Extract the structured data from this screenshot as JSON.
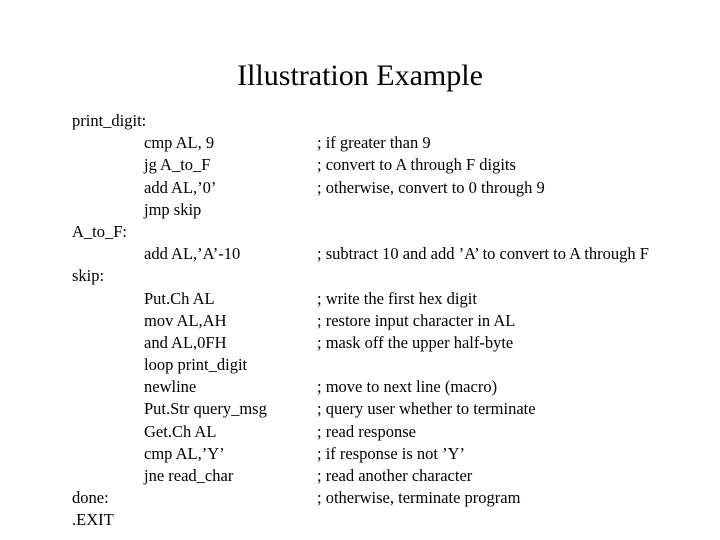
{
  "slide": {
    "title": "Illustration Example",
    "code_lines": [
      {
        "label": "print_digit:",
        "instr": "",
        "comment": ""
      },
      {
        "label": "",
        "instr": "cmp AL, 9",
        "comment": "; if greater than 9"
      },
      {
        "label": "",
        "instr": "jg A_to_F",
        "comment": "; convert to A through F digits"
      },
      {
        "label": "",
        "instr": "add AL,’0’",
        "comment": "; otherwise, convert to 0 through 9"
      },
      {
        "label": "",
        "instr": "jmp skip",
        "comment": ""
      },
      {
        "label": "A_to_F:",
        "instr": "",
        "comment": ""
      },
      {
        "label": "",
        "instr": "add AL,’A’-10",
        "comment": "; subtract 10 and add ’A’ to convert to A through F"
      },
      {
        "label": "skip:",
        "instr": "",
        "comment": ""
      },
      {
        "label": "",
        "instr": "Put.Ch AL",
        "comment": "; write the first hex digit"
      },
      {
        "label": "",
        "instr": "mov AL,AH",
        "comment": "; restore input character in AL"
      },
      {
        "label": "",
        "instr": "and AL,0FH",
        "comment": "; mask off the upper half-byte"
      },
      {
        "label": "",
        "instr": "loop print_digit",
        "comment": ""
      },
      {
        "label": "",
        "instr": "newline",
        "comment": "; move to next line (macro)"
      },
      {
        "label": "",
        "instr": "Put.Str query_msg",
        "comment": "; query user whether to terminate"
      },
      {
        "label": "",
        "instr": "Get.Ch AL",
        "comment": "; read response"
      },
      {
        "label": "",
        "instr": "cmp AL,’Y’",
        "comment": "; if response is not ’Y’"
      },
      {
        "label": "",
        "instr": "jne read_char",
        "comment": "; read another character"
      },
      {
        "label": "done:",
        "instr": "",
        "comment": "; otherwise, terminate program"
      },
      {
        "label": ".EXIT",
        "instr": "",
        "comment": ""
      }
    ]
  }
}
